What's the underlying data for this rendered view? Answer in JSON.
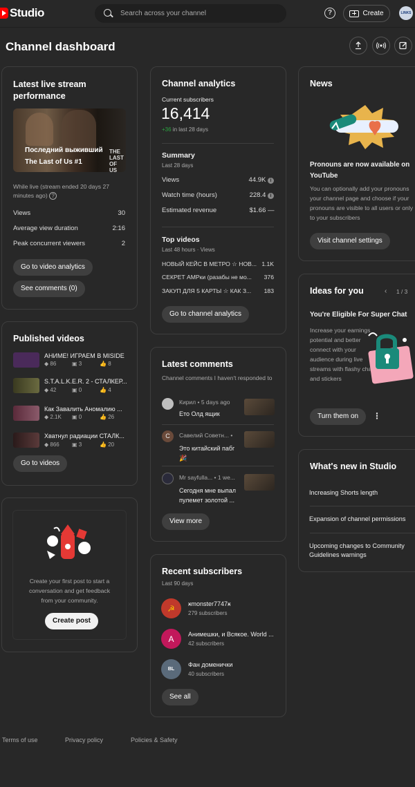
{
  "topbar": {
    "logo_text": "Studio",
    "search_placeholder": "Search across your channel",
    "help_label": "?",
    "create_label": "Create",
    "avatar_text": "LINKS LIVE"
  },
  "header": {
    "title": "Channel dashboard"
  },
  "live_stream": {
    "title": "Latest live stream performance",
    "thumb_title_1": "Последний выживший",
    "thumb_title_2": "The Last of Us #1",
    "thumb_logo": "THE LAST OF US",
    "status": "While live (stream ended 20 days 27 minutes ago)",
    "metrics": [
      {
        "label": "Views",
        "value": "30"
      },
      {
        "label": "Average view duration",
        "value": "2:16"
      },
      {
        "label": "Peak concurrent viewers",
        "value": "2"
      }
    ],
    "analytics_button": "Go to video analytics",
    "comments_button": "See comments (0)"
  },
  "published": {
    "title": "Published videos",
    "videos": [
      {
        "title": "АНИМЕ! ИГРАЕМ В MISIDE",
        "views": "86",
        "comments": "3",
        "likes": "8",
        "color": "#4a2a5a"
      },
      {
        "title": "S.T.A.L.K.E.R. 2 - СТАЛКЕР...",
        "views": "42",
        "comments": "0",
        "likes": "4",
        "color": "#5a5a30"
      },
      {
        "title": "Как Завалить Аномалию ...",
        "views": "2.1K",
        "comments": "0",
        "likes": "26",
        "color": "#6a3a4a"
      },
      {
        "title": "Хватнул радиации СТАЛК...",
        "views": "866",
        "comments": "3",
        "likes": "20",
        "color": "#3a2a2a"
      }
    ],
    "button": "Go to videos"
  },
  "post": {
    "text": "Create your first post to start a conversation and get feedback from your community.",
    "button": "Create post"
  },
  "analytics": {
    "title": "Channel analytics",
    "subs_label": "Current subscribers",
    "subs_value": "16,414",
    "subs_change": "+36",
    "subs_change_suffix": " in last 28 days",
    "summary_title": "Summary",
    "summary_period": "Last 28 days",
    "summary": [
      {
        "label": "Views",
        "value": "44.9K",
        "trend": "i"
      },
      {
        "label": "Watch time (hours)",
        "value": "228.4",
        "trend": "i"
      },
      {
        "label": "Estimated revenue",
        "value": "$1.66",
        "trend": "—"
      }
    ],
    "top_title": "Top videos",
    "top_period": "Last 48 hours · Views",
    "top_videos": [
      {
        "title": "НОВЫЙ КЕЙС В МЕТРО ☆ НОВ...",
        "value": "1.1K"
      },
      {
        "title": "СЕКРЕТ АМРки (разабы не мо...",
        "value": "376"
      },
      {
        "title": "ЗАКУП ДЛЯ 5 КАРТЫ ☆ КАК З...",
        "value": "183"
      }
    ],
    "button": "Go to channel analytics"
  },
  "comments": {
    "title": "Latest comments",
    "subtitle": "Channel comments I haven't responded to",
    "items": [
      {
        "name": "Кирил • 5 days ago",
        "text": "Ето Олд ящик",
        "avatar_color": "#bfbfbf"
      },
      {
        "name": "Савелий Советн... •",
        "text": "Это китайский пабг 🎉",
        "avatar_color": "#6a4a3a",
        "avatar_letter": "C"
      },
      {
        "name": "Mr sayfulla... • 1 we...",
        "text": "Сегодня мне выпал пулемет золотой ...",
        "avatar_color": "#2a2a3a"
      }
    ],
    "button": "View more"
  },
  "subscribers": {
    "title": "Recent subscribers",
    "period": "Last 90 days",
    "items": [
      {
        "name": "ӿmonster7747ӿ",
        "count": "279 subscribers",
        "color": "#c0392b",
        "letter": "☭"
      },
      {
        "name": "Анимешки, и Всякое. World ...",
        "count": "42 subscribers",
        "color": "#c2185b",
        "letter": "A"
      },
      {
        "name": "Фан доменички",
        "count": "40 subscribers",
        "color": "#5a6a7a",
        "letter": "BL"
      }
    ],
    "button": "See all"
  },
  "news": {
    "title": "News",
    "headline": "Pronouns are now available on YouTube",
    "body": "You can optionally add your pronouns your channel page and choose if your pronouns are visible to all users or only to your subscribers",
    "button": "Visit channel settings"
  },
  "ideas": {
    "title": "Ideas for you",
    "pager": "1 / 3",
    "headline": "You're Eligible For Super Chat",
    "body": "Increase your earnings potential and better connect with your audience during live streams with flashy chats and stickers",
    "button": "Turn them on"
  },
  "whats_new": {
    "title": "What's new in Studio",
    "items": [
      "Increasing Shorts length",
      "Expansion of channel permissions",
      "Upcoming changes to Community Guidelines warnings"
    ]
  },
  "footer": {
    "terms": "Terms of use",
    "privacy": "Privacy policy",
    "policies": "Policies & Safety"
  }
}
